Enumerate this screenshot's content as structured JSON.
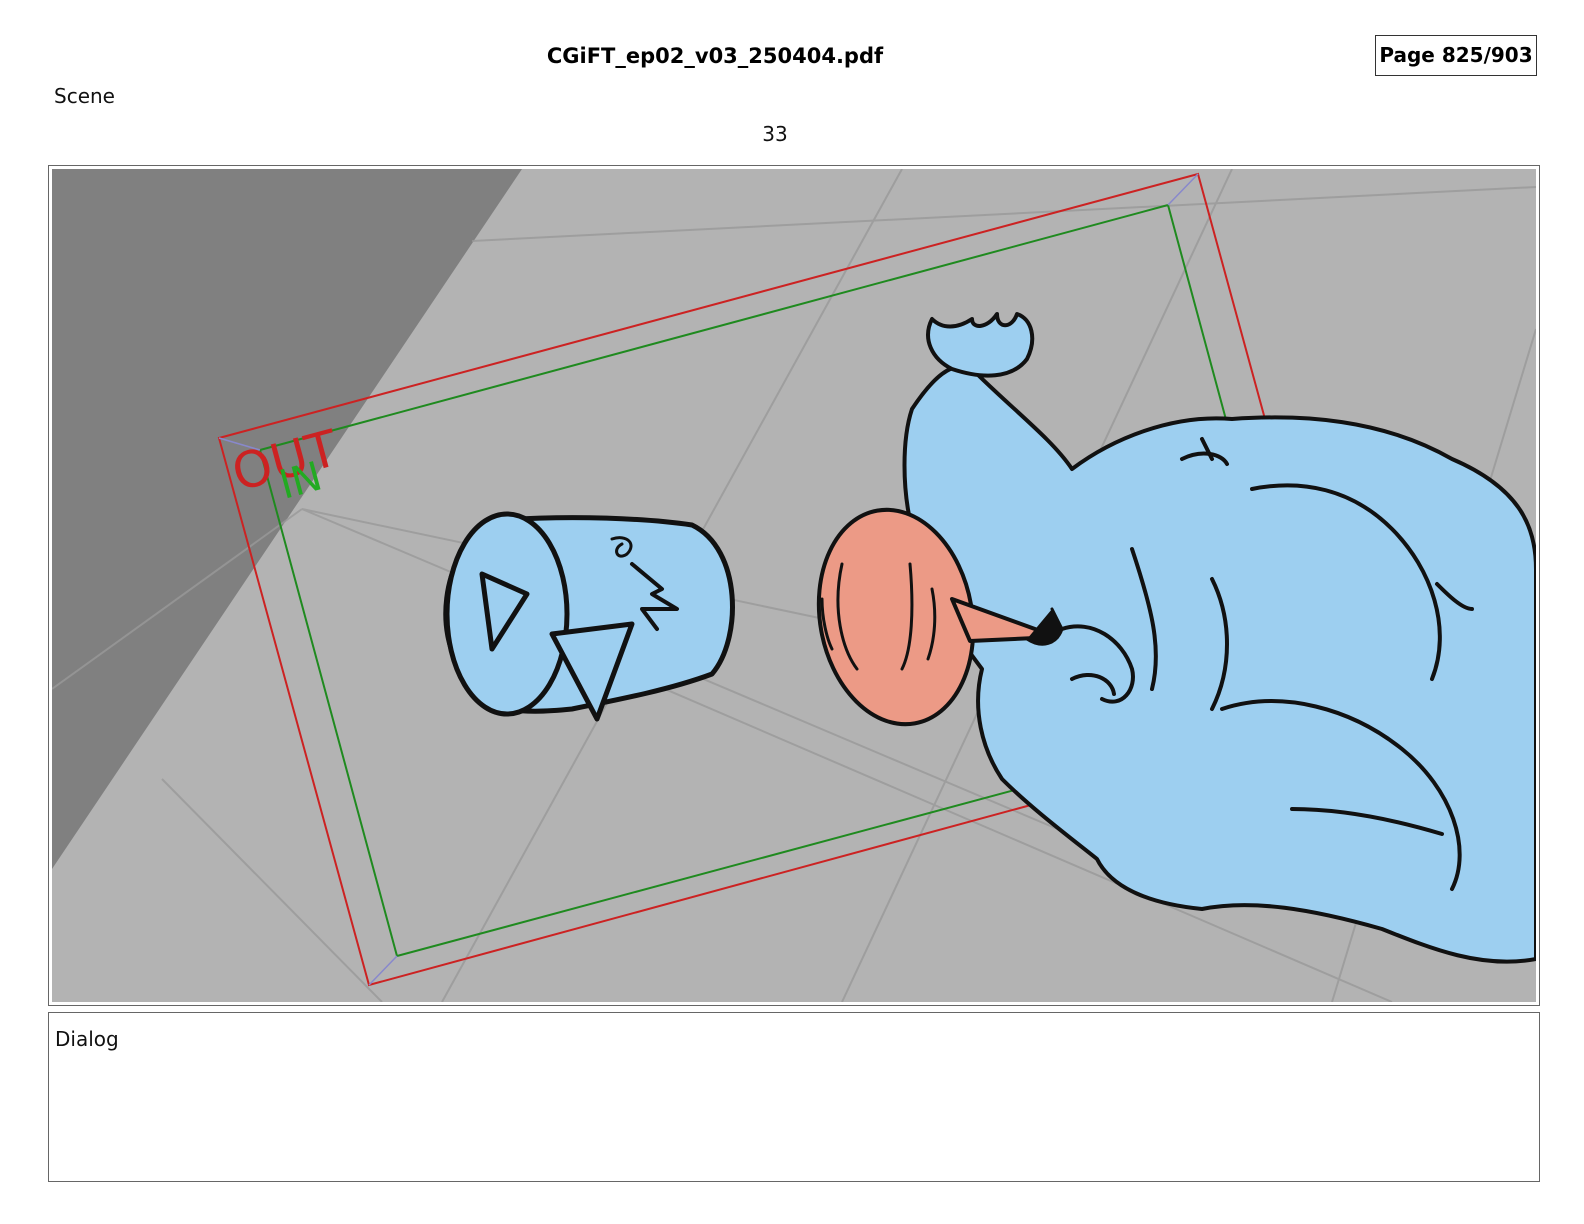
{
  "header": {
    "file_name": "CGiFT_ep02_v03_250404.pdf",
    "page_indicator": "Page 825/903"
  },
  "scene": {
    "label": "Scene",
    "number": "33"
  },
  "panel": {
    "frame_labels": {
      "out": "OUT",
      "in": "IN"
    },
    "colors": {
      "floor": "#b3b3b3",
      "shadow": "#808080",
      "out_frame": "#cc2222",
      "in_frame": "#1f8a1f",
      "character": "#9dcff0",
      "head": "#ec9a86",
      "ink": "#111111"
    }
  },
  "dialog": {
    "label": "Dialog",
    "text": ""
  }
}
